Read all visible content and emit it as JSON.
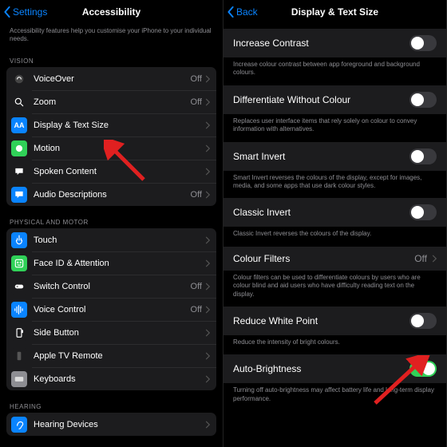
{
  "left": {
    "back": "Settings",
    "title": "Accessibility",
    "subtitle": "Accessibility features help you customise your iPhone to your individual needs.",
    "sections": [
      {
        "header": "VISION",
        "items": [
          {
            "icon": "voiceover",
            "bg": "#1c1c1e",
            "glyph": "vo",
            "label": "VoiceOver",
            "value": "Off"
          },
          {
            "icon": "zoom",
            "bg": "#1c1c1e",
            "glyph": "zoom",
            "label": "Zoom",
            "value": "Off"
          },
          {
            "icon": "display",
            "bg": "#0a84ff",
            "glyph": "AA",
            "label": "Display & Text Size",
            "value": ""
          },
          {
            "icon": "motion",
            "bg": "#30d158",
            "glyph": "motion",
            "label": "Motion",
            "value": ""
          },
          {
            "icon": "spoken",
            "bg": "#1c1c1e",
            "glyph": "bubble",
            "label": "Spoken Content",
            "value": ""
          },
          {
            "icon": "audio-desc",
            "bg": "#0a84ff",
            "glyph": "bubble",
            "label": "Audio Descriptions",
            "value": "Off"
          }
        ]
      },
      {
        "header": "PHYSICAL AND MOTOR",
        "items": [
          {
            "icon": "touch",
            "bg": "#0a84ff",
            "glyph": "touch",
            "label": "Touch",
            "value": ""
          },
          {
            "icon": "faceid",
            "bg": "#30d158",
            "glyph": "face",
            "label": "Face ID & Attention",
            "value": ""
          },
          {
            "icon": "switch",
            "bg": "#1c1c1e",
            "glyph": "switch",
            "label": "Switch Control",
            "value": "Off"
          },
          {
            "icon": "voice",
            "bg": "#0a84ff",
            "glyph": "voice",
            "label": "Voice Control",
            "value": "Off"
          },
          {
            "icon": "side",
            "bg": "#1c1c1e",
            "glyph": "side",
            "label": "Side Button",
            "value": ""
          },
          {
            "icon": "appletv",
            "bg": "#1c1c1e",
            "glyph": "tv",
            "label": "Apple TV Remote",
            "value": ""
          },
          {
            "icon": "keyboards",
            "bg": "#8e8e93",
            "glyph": "kb",
            "label": "Keyboards",
            "value": ""
          }
        ]
      },
      {
        "header": "HEARING",
        "items": [
          {
            "icon": "hearing",
            "bg": "#0a84ff",
            "glyph": "ear",
            "label": "Hearing Devices",
            "value": ""
          }
        ]
      }
    ]
  },
  "right": {
    "back": "Back",
    "title": "Display & Text Size",
    "items": [
      {
        "label": "Increase Contrast",
        "type": "toggle",
        "on": false,
        "desc": "Increase colour contrast between app foreground and background colours."
      },
      {
        "label": "Differentiate Without Colour",
        "type": "toggle",
        "on": false,
        "desc": "Replaces user interface items that rely solely on colour to convey information with alternatives."
      },
      {
        "label": "Smart Invert",
        "type": "toggle",
        "on": false,
        "desc": "Smart Invert reverses the colours of the display, except for images, media, and some apps that use dark colour styles."
      },
      {
        "label": "Classic Invert",
        "type": "toggle",
        "on": false,
        "desc": "Classic Invert reverses the colours of the display."
      },
      {
        "label": "Colour Filters",
        "type": "link",
        "value": "Off",
        "desc": "Colour filters can be used to differentiate colours by users who are colour blind and aid users who have difficulty reading text on the display."
      },
      {
        "label": "Reduce White Point",
        "type": "toggle",
        "on": false,
        "desc": "Reduce the intensity of bright colours."
      },
      {
        "label": "Auto-Brightness",
        "type": "toggle",
        "on": true,
        "desc": "Turning off auto-brightness may affect battery life and long-term display performance."
      }
    ]
  }
}
